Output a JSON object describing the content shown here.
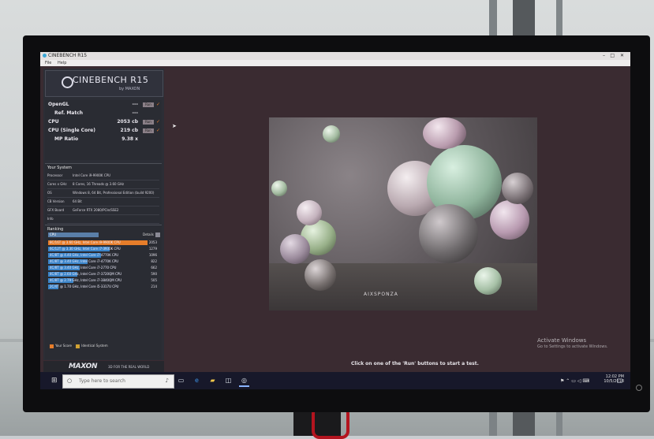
{
  "app": {
    "title": "CINEBENCH R15",
    "menu": [
      "File",
      "Help"
    ]
  },
  "logo": {
    "name": "CINEBENCH R15",
    "by": "by MAXON"
  },
  "results": [
    {
      "label": "OpenGL",
      "value": "---",
      "run": "Run"
    },
    {
      "label": "Ref. Match",
      "value": "---",
      "run": ""
    },
    {
      "label": "CPU",
      "value": "2053 cb",
      "run": "Run"
    },
    {
      "label": "CPU (Single Core)",
      "value": "219 cb",
      "run": "Run"
    },
    {
      "label": "MP Ratio",
      "value": "9.38 x",
      "run": ""
    }
  ],
  "system": {
    "header": "Your System",
    "rows": [
      {
        "k": "Processor",
        "v": "Intel Core i9-9900K CPU"
      },
      {
        "k": "Cores x GHz",
        "v": "8 Cores, 16 Threads @ 3.60 GHz"
      },
      {
        "k": "OS",
        "v": "Windows 8, 64 Bit, Professional Edition (build 9200)"
      },
      {
        "k": "CB Version",
        "v": "64 Bit"
      },
      {
        "k": "GFX Board",
        "v": "GeForce RTX 2080/PCIe/SSE2"
      },
      {
        "k": "Info",
        "v": ""
      }
    ]
  },
  "ranking": {
    "header": "Ranking",
    "selector": "CPU",
    "details": "Details",
    "rows": [
      {
        "name": "8C/16T @ 3.60 GHz, Intel Core i9-9900K CPU",
        "score": "2053",
        "fraction": 1.0,
        "me": true
      },
      {
        "name": "6C/12T @ 3.30 GHz, Intel Core i7-3930K CPU",
        "score": "1279",
        "fraction": 0.62,
        "me": false
      },
      {
        "name": "4C/8T @ 4.40 GHz, Intel Core i7-4770K CPU",
        "score": "1096",
        "fraction": 0.53,
        "me": false
      },
      {
        "name": "4C/8T @ 3.40 GHz, Intel Core i7-4770K CPU",
        "score": "822",
        "fraction": 0.4,
        "me": false
      },
      {
        "name": "4C/8T @ 3.40 GHz, Intel Core i7-2770 CPU",
        "score": "662",
        "fraction": 0.32,
        "me": false
      },
      {
        "name": "4C/8T @ 2.60 GHz, Intel Core i7-3720QM CPU",
        "score": "590",
        "fraction": 0.29,
        "me": false
      },
      {
        "name": "4C/8T @ 2.79 GHz, Intel Core i7-3840QM CPU",
        "score": "505",
        "fraction": 0.25,
        "me": false
      },
      {
        "name": "2C/4T @ 1.70 GHz, Intel Core i5-3317U CPU",
        "score": "214",
        "fraction": 0.1,
        "me": false
      }
    ]
  },
  "legend": {
    "your_score": "Your Score",
    "identical": "Identical System"
  },
  "maxon": {
    "logo": "MAXON",
    "tagline": "3D FOR THE REAL WORLD"
  },
  "render": {
    "watermark": "AIXSPONZA"
  },
  "status": {
    "message": "Click on one of the 'Run' buttons to start a test."
  },
  "activation": {
    "title": "Activate Windows",
    "sub": "Go to Settings to activate Windows."
  },
  "taskbar": {
    "search_placeholder": "Type here to search",
    "time": "12:02 PM",
    "date": "10/5/2018"
  },
  "colors": {
    "accent_orange": "#e67d2a",
    "rank_blue": "#3b84c8",
    "brand_red": "#b3141f"
  }
}
